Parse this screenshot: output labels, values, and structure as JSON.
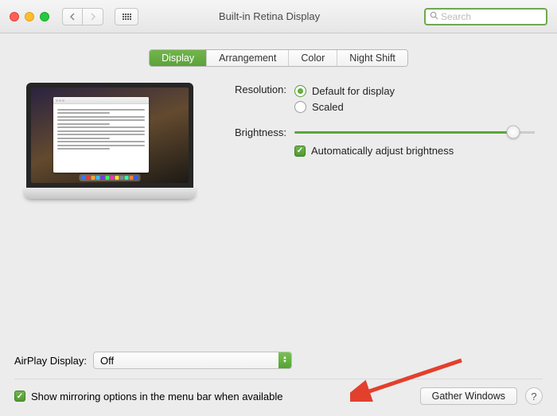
{
  "window": {
    "title": "Built-in Retina Display",
    "search_placeholder": "Search"
  },
  "tabs": {
    "items": [
      "Display",
      "Arrangement",
      "Color",
      "Night Shift"
    ],
    "active": "Display"
  },
  "settings": {
    "resolution": {
      "label": "Resolution:",
      "options": {
        "default": "Default for display",
        "scaled": "Scaled"
      },
      "selected": "default"
    },
    "brightness": {
      "label": "Brightness:",
      "auto_label": "Automatically adjust brightness",
      "auto_checked": true,
      "value_pct": 91
    }
  },
  "footer": {
    "airplay_label": "AirPlay Display:",
    "airplay_value": "Off",
    "mirror_label": "Show mirroring options in the menu bar when available",
    "mirror_checked": true,
    "gather_label": "Gather Windows",
    "help_label": "?"
  }
}
